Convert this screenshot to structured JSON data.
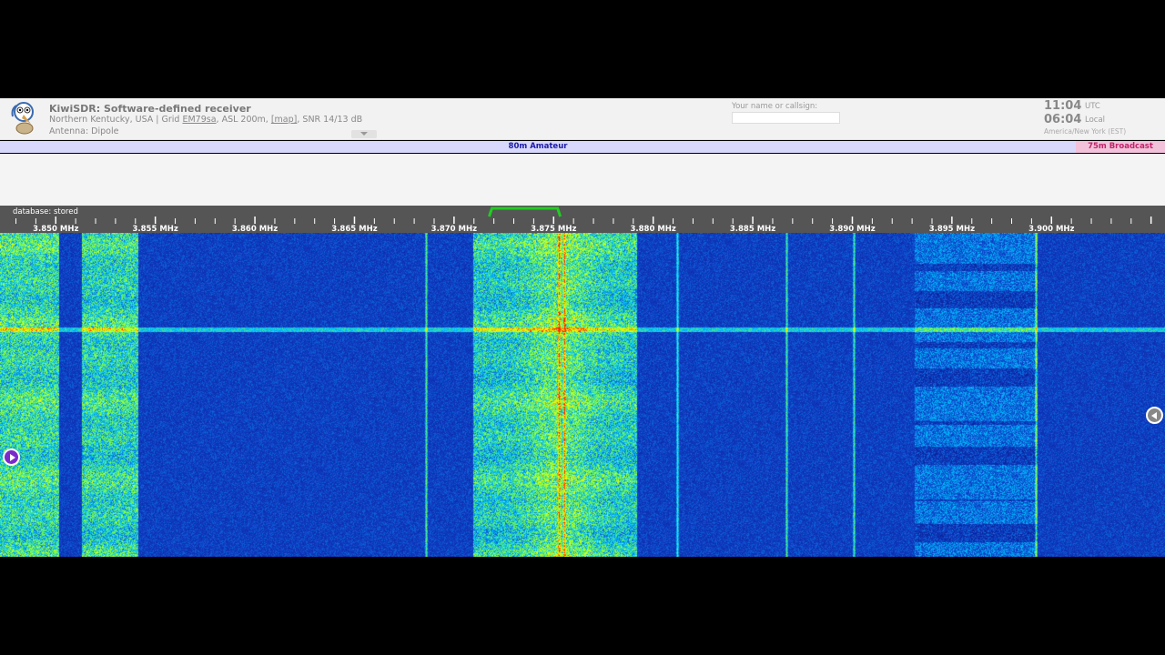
{
  "header": {
    "title": "KiwiSDR: Software-defined receiver",
    "location_prefix": "Northern Kentucky, USA | Grid ",
    "grid": "EM79sa",
    "asl": ", ASL 200m, ",
    "map_link": "[map]",
    "snr": ", SNR 14/13 dB",
    "antenna": "Antenna: Dipole",
    "ident_label": "Your name or callsign:",
    "ident_value": ""
  },
  "clock": {
    "utc_time": "11:04",
    "utc_label": "UTC",
    "local_time": "06:04",
    "local_label": "Local",
    "timezone": "America/New York (EST)"
  },
  "bands": {
    "amateur": "80m Amateur",
    "broadcast": "75m Broadcast",
    "amateur_color": "#1a1aa6",
    "broadcast_color": "#c0246a"
  },
  "scale": {
    "database_label": "database: stored",
    "freq_labels": [
      "3.850 MHz",
      "3.855 MHz",
      "3.860 MHz",
      "3.865 MHz",
      "3.870 MHz",
      "3.875 MHz",
      "3.880 MHz",
      "3.885 MHz",
      "3.890 MHz",
      "3.895 MHz",
      "3.900 MHz"
    ],
    "freq_start_mhz": 3.8472,
    "freq_end_mhz": 3.9057,
    "passband_mhz": [
      3.8719,
      3.8752
    ],
    "passband_color": "#22cc22"
  },
  "waterfall": {
    "colors": [
      "#0a1a8c",
      "#1040c8",
      "#00c0ff",
      "#80ff40",
      "#ffff00",
      "#ff2000"
    ]
  }
}
